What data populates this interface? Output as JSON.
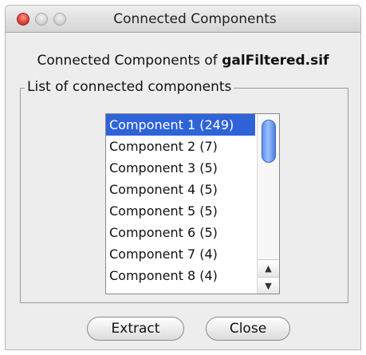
{
  "window": {
    "title": "Connected Components"
  },
  "heading": {
    "prefix": "Connected Components of ",
    "filename": "galFiltered.sif"
  },
  "group": {
    "legend": "List of connected components"
  },
  "components_list": {
    "items": [
      "Component 1 (249)",
      "Component 2 (7)",
      "Component 3 (5)",
      "Component 4 (5)",
      "Component 5 (5)",
      "Component 6 (5)",
      "Component 7 (4)",
      "Component 8 (4)"
    ],
    "selected_index": 0
  },
  "buttons": {
    "extract": "Extract",
    "close": "Close"
  },
  "colors": {
    "selection": "#2f63d8",
    "window_bg": "#ededed"
  }
}
